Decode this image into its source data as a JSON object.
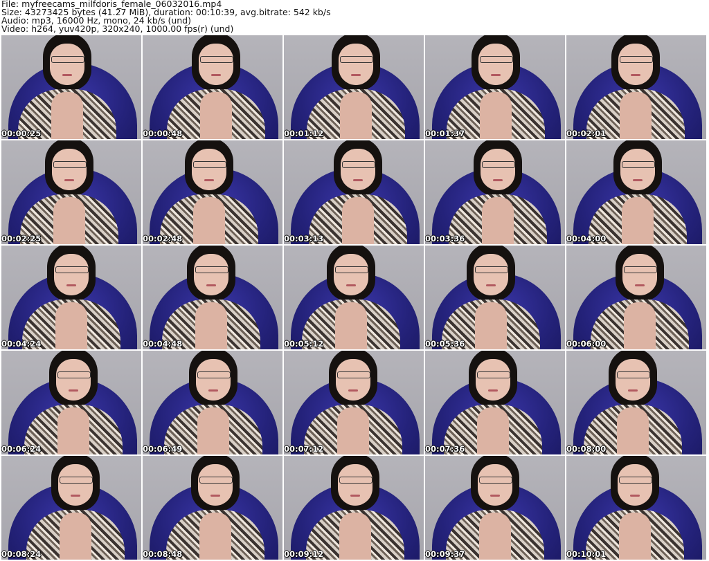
{
  "header": {
    "file": "File: myfreecams_milfdoris_female_06032016.mp4",
    "size": "Size: 43273425 bytes (41.27 MiB), duration: 00:10:39, avg.bitrate: 542 kb/s",
    "audio": "Audio: mp3, 16000 Hz, mono, 24 kb/s (und)",
    "video": "Video: h264, yuv420p, 320x240, 1000.00 fps(r) (und)"
  },
  "thumbnails": [
    {
      "time": "00:00:25"
    },
    {
      "time": "00:00:48"
    },
    {
      "time": "00:01:12"
    },
    {
      "time": "00:01:37"
    },
    {
      "time": "00:02:01"
    },
    {
      "time": "00:02:25"
    },
    {
      "time": "00:02:48"
    },
    {
      "time": "00:03:13"
    },
    {
      "time": "00:03:36"
    },
    {
      "time": "00:04:00"
    },
    {
      "time": "00:04:24"
    },
    {
      "time": "00:04:48"
    },
    {
      "time": "00:05:12"
    },
    {
      "time": "00:05:36"
    },
    {
      "time": "00:06:00"
    },
    {
      "time": "00:06:24"
    },
    {
      "time": "00:06:49"
    },
    {
      "time": "00:07:12"
    },
    {
      "time": "00:07:36"
    },
    {
      "time": "00:08:00"
    },
    {
      "time": "00:08:24"
    },
    {
      "time": "00:08:48"
    },
    {
      "time": "00:09:12"
    },
    {
      "time": "00:09:37"
    },
    {
      "time": "00:10:01"
    }
  ]
}
